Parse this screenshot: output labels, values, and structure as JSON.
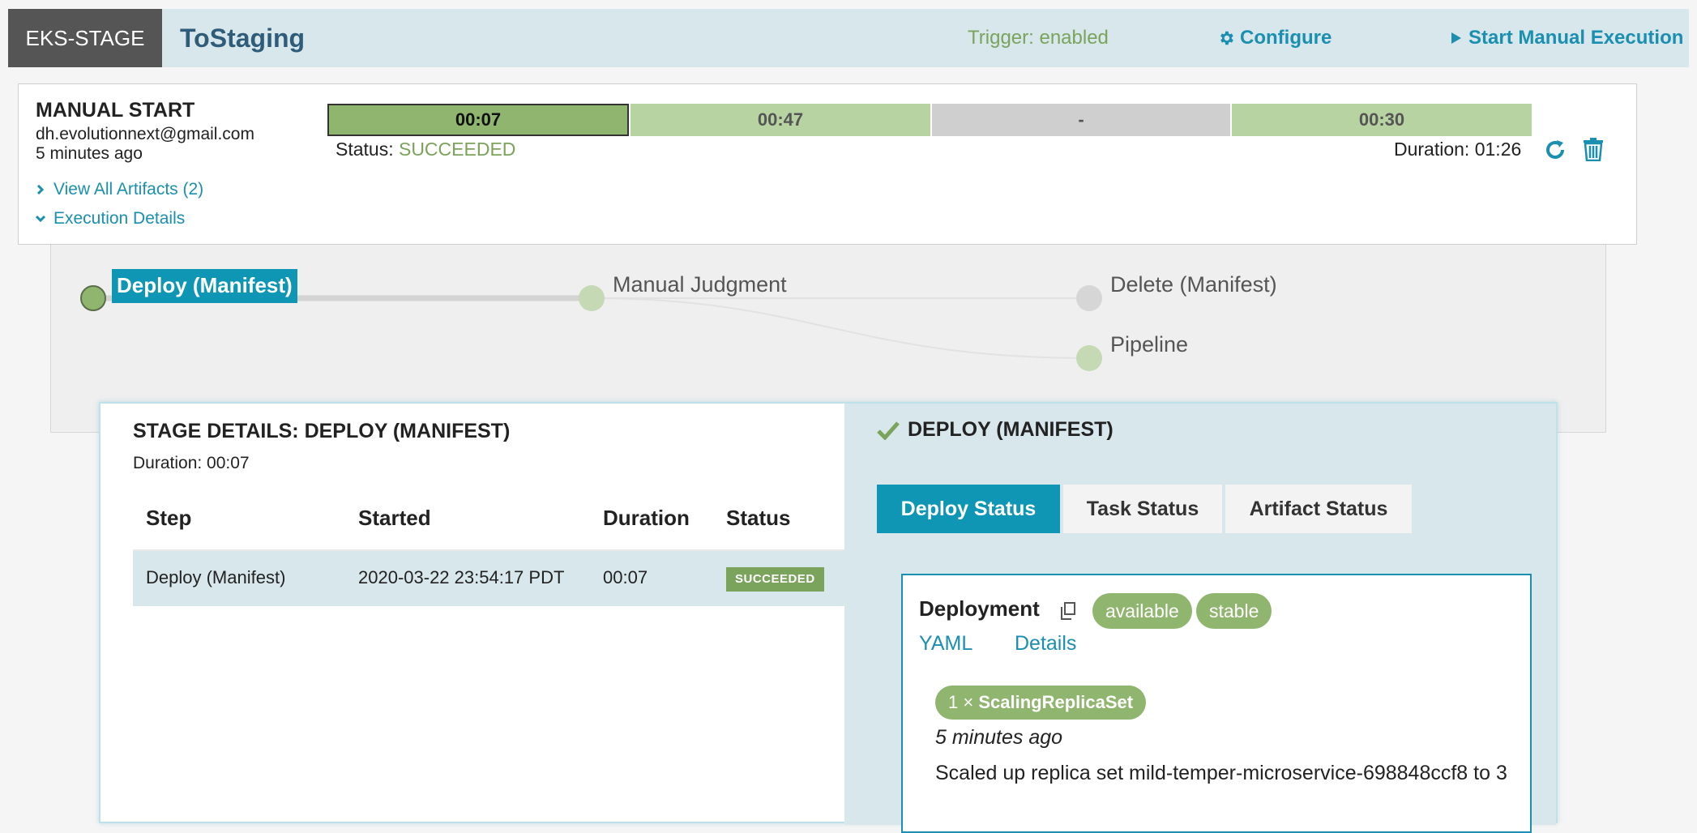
{
  "header": {
    "app_name": "EKS-STAGE",
    "pipeline_name": "ToStaging",
    "trigger_text": "Trigger: enabled",
    "configure_label": "Configure",
    "start_label": "Start Manual Execution"
  },
  "execution": {
    "trigger_type": "MANUAL START",
    "user": "dh.evolutionnext@gmail.com",
    "time_ago": "5 minutes ago",
    "artifacts_link": "View All Artifacts (2)",
    "details_link": "Execution Details",
    "segments": [
      "00:07",
      "00:47",
      "-",
      "00:30"
    ],
    "status_label": "Status: ",
    "status_value": "SUCCEEDED",
    "duration_text": "Duration: 01:26"
  },
  "graph": {
    "nodes": [
      "Deploy (Manifest)",
      "Manual Judgment",
      "Delete (Manifest)",
      "Pipeline"
    ]
  },
  "stage_details": {
    "title": "STAGE DETAILS: DEPLOY (MANIFEST)",
    "duration": "Duration: 00:07",
    "columns": [
      "Step",
      "Started",
      "Duration",
      "Status"
    ],
    "row": {
      "step": "Deploy (Manifest)",
      "started": "2020-03-22 23:54:17 PDT",
      "duration": "00:07",
      "status": "SUCCEEDED"
    }
  },
  "right_panel": {
    "title": "DEPLOY (MANIFEST)",
    "tabs": [
      "Deploy Status",
      "Task Status",
      "Artifact Status"
    ],
    "deployment": {
      "kind": "Deployment",
      "badges": [
        "available",
        "stable"
      ],
      "links": [
        "YAML",
        "Details"
      ],
      "event_count": "1 ×",
      "event_reason": "ScalingReplicaSet",
      "event_time": "5 minutes ago",
      "event_message": "Scaled up replica set mild-temper-microservice-698848ccf8 to 3"
    }
  },
  "colors": {
    "accent": "#0e96b4",
    "success": "#7aa35b",
    "header_bg": "#d8e7ec"
  },
  "icons": [
    "gear-icon",
    "play-icon",
    "chevron-right-icon",
    "chevron-down-icon",
    "rerun-icon",
    "trash-icon",
    "check-icon",
    "clone-icon"
  ]
}
